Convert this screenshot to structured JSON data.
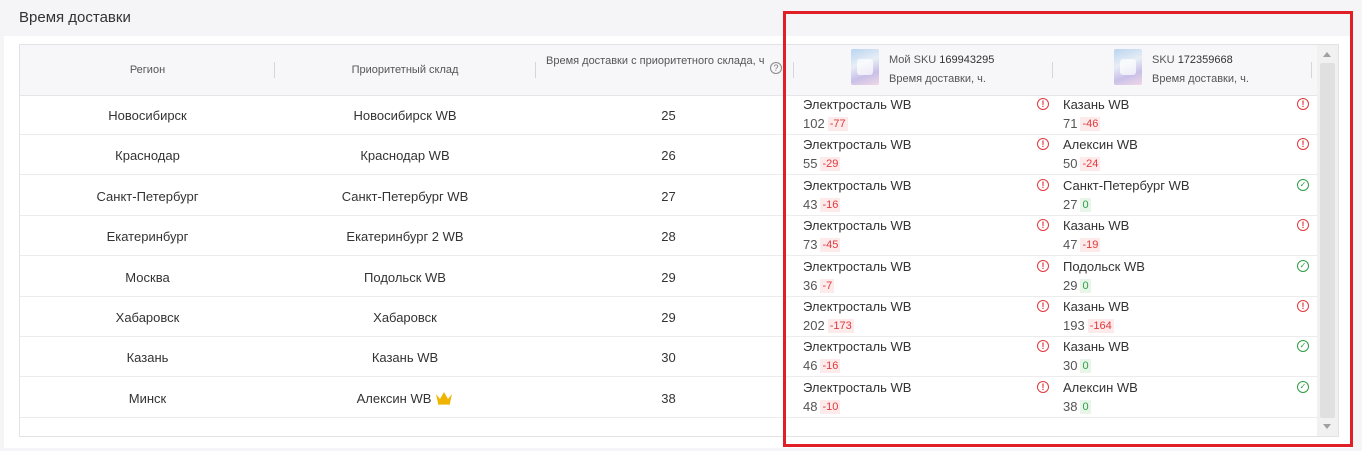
{
  "title": "Время доставки",
  "columns": {
    "region": "Регион",
    "warehouse": "Приоритетный склад",
    "time": "Время доставки с приоритетного склада, ч",
    "help": "?"
  },
  "sku": [
    {
      "label": "Мой SKU",
      "id": "169943295",
      "subtitle": "Время доставки, ч."
    },
    {
      "label": "SKU",
      "id": "172359668",
      "subtitle": "Время доставки, ч."
    }
  ],
  "icons": {
    "bad": "exclamation-circle-icon",
    "good": "check-circle-icon",
    "crown": "crown-icon"
  },
  "colors": {
    "bad": "#e0393e",
    "good": "#2f9d44",
    "highlight": "#e01e26",
    "crown": "#f0b400"
  },
  "rows": [
    {
      "region": "Новосибирск",
      "warehouse": "Новосибирск WB",
      "crown": false,
      "time": "25",
      "sku1": {
        "warehouse": "Электросталь WB",
        "time": "102",
        "delta": "-77",
        "status": "bad"
      },
      "sku2": {
        "warehouse": "Казань WB",
        "time": "71",
        "delta": "-46",
        "status": "bad"
      }
    },
    {
      "region": "Краснодар",
      "warehouse": "Краснодар WB",
      "crown": false,
      "time": "26",
      "sku1": {
        "warehouse": "Электросталь WB",
        "time": "55",
        "delta": "-29",
        "status": "bad"
      },
      "sku2": {
        "warehouse": "Алексин WB",
        "time": "50",
        "delta": "-24",
        "status": "bad"
      }
    },
    {
      "region": "Санкт-Петербург",
      "warehouse": "Санкт-Петербург WB",
      "crown": false,
      "time": "27",
      "sku1": {
        "warehouse": "Электросталь WB",
        "time": "43",
        "delta": "-16",
        "status": "bad"
      },
      "sku2": {
        "warehouse": "Санкт-Петербург WB",
        "time": "27",
        "delta": "0",
        "status": "good"
      }
    },
    {
      "region": "Екатеринбург",
      "warehouse": "Екатеринбург 2 WB",
      "crown": false,
      "time": "28",
      "sku1": {
        "warehouse": "Электросталь WB",
        "time": "73",
        "delta": "-45",
        "status": "bad"
      },
      "sku2": {
        "warehouse": "Казань WB",
        "time": "47",
        "delta": "-19",
        "status": "bad"
      }
    },
    {
      "region": "Москва",
      "warehouse": "Подольск WB",
      "crown": false,
      "time": "29",
      "sku1": {
        "warehouse": "Электросталь WB",
        "time": "36",
        "delta": "-7",
        "status": "bad"
      },
      "sku2": {
        "warehouse": "Подольск WB",
        "time": "29",
        "delta": "0",
        "status": "good"
      }
    },
    {
      "region": "Хабаровск",
      "warehouse": "Хабаровск",
      "crown": false,
      "time": "29",
      "sku1": {
        "warehouse": "Электросталь WB",
        "time": "202",
        "delta": "-173",
        "status": "bad"
      },
      "sku2": {
        "warehouse": "Казань WB",
        "time": "193",
        "delta": "-164",
        "status": "bad"
      }
    },
    {
      "region": "Казань",
      "warehouse": "Казань WB",
      "crown": false,
      "time": "30",
      "sku1": {
        "warehouse": "Электросталь WB",
        "time": "46",
        "delta": "-16",
        "status": "bad"
      },
      "sku2": {
        "warehouse": "Казань WB",
        "time": "30",
        "delta": "0",
        "status": "good"
      }
    },
    {
      "region": "Минск",
      "warehouse": "Алексин WB",
      "crown": true,
      "time": "38",
      "sku1": {
        "warehouse": "Электросталь WB",
        "time": "48",
        "delta": "-10",
        "status": "bad"
      },
      "sku2": {
        "warehouse": "Алексин WB",
        "time": "38",
        "delta": "0",
        "status": "good"
      }
    }
  ]
}
